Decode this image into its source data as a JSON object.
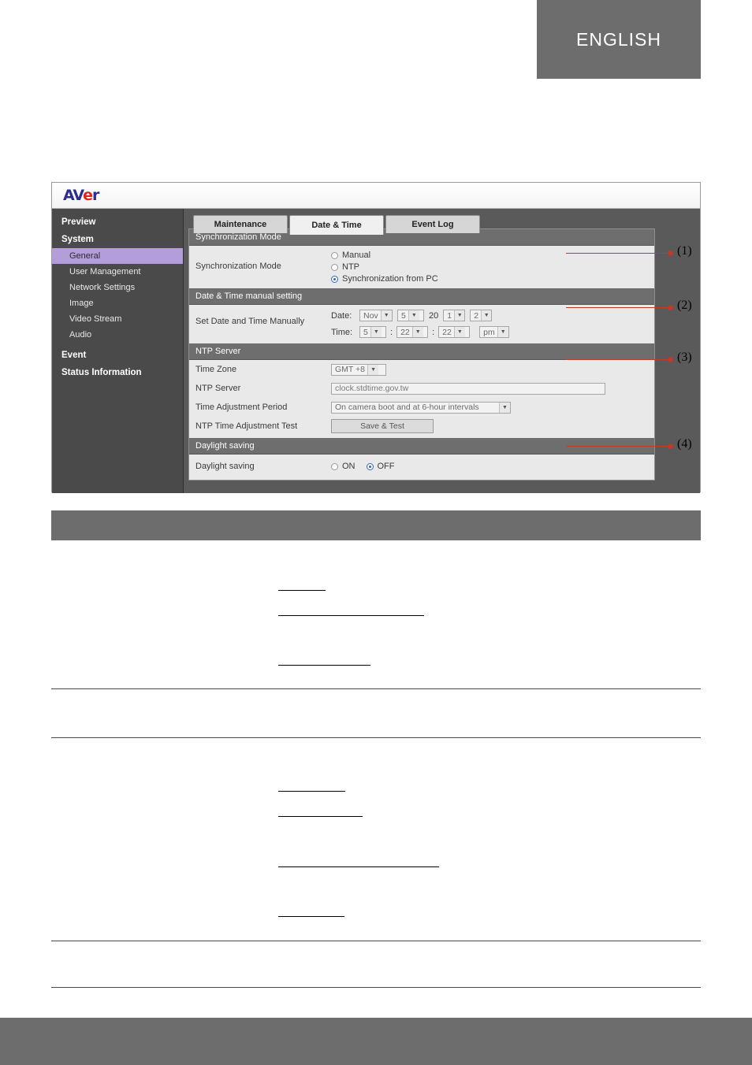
{
  "page": {
    "language_tab": "ENGLISH"
  },
  "figure": {
    "brand": {
      "a": "A",
      "v": "V",
      "e": "e",
      "r": "r"
    },
    "sidebar": {
      "items": [
        {
          "label": "Preview",
          "level": "top",
          "active": false
        },
        {
          "label": "System",
          "level": "top",
          "active": false
        },
        {
          "label": "General",
          "level": "sub",
          "active": true
        },
        {
          "label": "User Management",
          "level": "sub",
          "active": false
        },
        {
          "label": "Network Settings",
          "level": "sub",
          "active": false
        },
        {
          "label": "Image",
          "level": "sub",
          "active": false
        },
        {
          "label": "Video Stream",
          "level": "sub",
          "active": false
        },
        {
          "label": "Audio",
          "level": "sub",
          "active": false
        },
        {
          "label": "Event",
          "level": "top",
          "active": false
        },
        {
          "label": "Status Information",
          "level": "top",
          "active": false
        }
      ]
    },
    "tabs": [
      {
        "label": "Maintenance",
        "active": false
      },
      {
        "label": "Date & Time",
        "active": true
      },
      {
        "label": "Event Log",
        "active": false
      }
    ],
    "sections": {
      "sync": {
        "header": "Synchronization Mode",
        "row_label": "Synchronization Mode",
        "options": [
          {
            "label": "Manual",
            "selected": false
          },
          {
            "label": "NTP",
            "selected": false
          },
          {
            "label": "Synchronization from PC",
            "selected": true
          }
        ]
      },
      "manual": {
        "header": "Date & Time manual setting",
        "row_label": "Set Date and Time Manually",
        "date_label": "Date:",
        "date_month": "Nov",
        "date_day": "5",
        "date_year_prefix": "20",
        "date_year_d1": "1",
        "date_year_d2": "2",
        "time_label": "Time:",
        "time_hour": "5",
        "time_min": "22",
        "time_sec": "22",
        "time_ampm": "pm",
        "colon": ":"
      },
      "ntp": {
        "header": "NTP Server",
        "timezone_label": "Time Zone",
        "timezone_value": "GMT +8",
        "server_label": "NTP Server",
        "server_value": "clock.stdtime.gov.tw",
        "period_label": "Time Adjustment Period",
        "period_value": "On camera boot and at 6-hour intervals",
        "test_label": "NTP Time Adjustment Test",
        "test_button": "Save & Test"
      },
      "daylight": {
        "header": "Daylight saving",
        "row_label": "Daylight saving",
        "options": [
          {
            "label": "ON",
            "selected": false
          },
          {
            "label": "OFF",
            "selected": true
          }
        ]
      }
    }
  },
  "callouts": [
    {
      "label": "(1)"
    },
    {
      "label": "(2)"
    },
    {
      "label": "(3)"
    },
    {
      "label": "(4)"
    }
  ]
}
